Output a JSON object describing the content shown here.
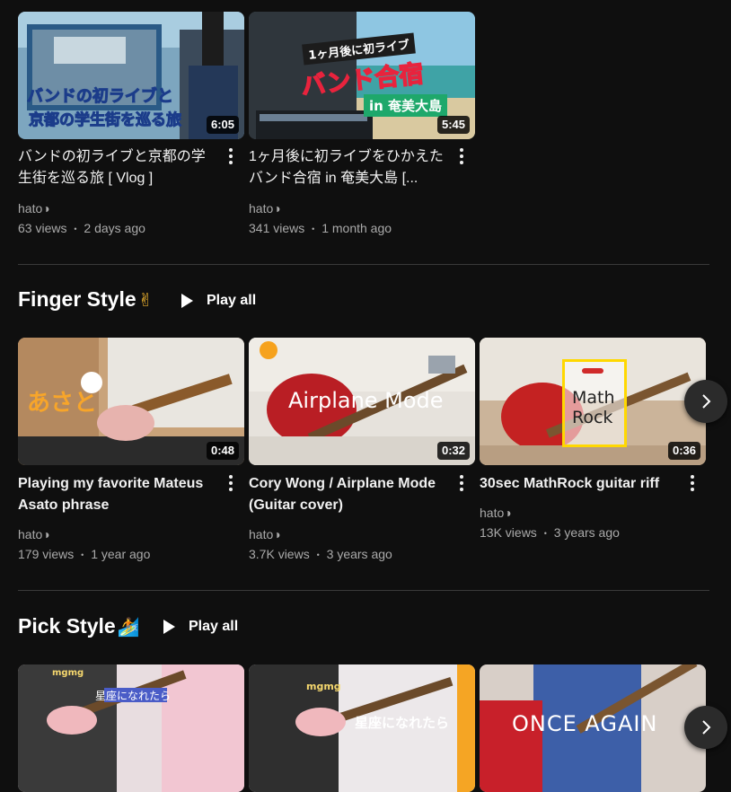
{
  "top_row": [
    {
      "title": "バンドの初ライブと京都の学生街を巡る旅 [ Vlog ]",
      "channel": "hato◑",
      "views": "63 views",
      "age": "2 days ago",
      "duration": "6:05",
      "overlay_line1": "バンドの初ライブと",
      "overlay_line2": "京都の学生街を巡る旅"
    },
    {
      "title": "1ヶ月後に初ライブをひかえたバンド合宿 in 奄美大島 [...",
      "channel": "hato◑",
      "views": "341 views",
      "age": "1 month ago",
      "duration": "5:45",
      "overlay_top": "1ヶ月後に初ライブ",
      "overlay_main": "バンド合宿",
      "overlay_badge": "in 奄美大島"
    }
  ],
  "shelves": [
    {
      "title": "Finger Style",
      "emoji": "✌",
      "play_all_label": "Play all",
      "videos": [
        {
          "title": "Playing my favorite Mateus Asato phrase",
          "channel": "hato◑",
          "views": "179 views",
          "age": "1 year ago",
          "duration": "0:48",
          "overlay": "あさと"
        },
        {
          "title": "Cory Wong / Airplane Mode (Guitar cover)",
          "channel": "hato◑",
          "views": "3.7K views",
          "age": "3 years ago",
          "duration": "0:32",
          "overlay": "Airplane Mode"
        },
        {
          "title": "30sec MathRock guitar riff",
          "channel": "hato◑",
          "views": "13K views",
          "age": "3 years ago",
          "duration": "0:36",
          "overlay_line1": "Math",
          "overlay_line2": "Rock"
        }
      ]
    },
    {
      "title": "Pick Style",
      "emoji": "🏄",
      "play_all_label": "Play all",
      "videos": [
        {
          "overlay": "星座になれたら",
          "overlay2": "mgmg"
        },
        {
          "overlay": "星座になれたら",
          "overlay2": "mgmg"
        },
        {
          "overlay": "ONCE AGAIN"
        }
      ]
    }
  ],
  "meta_separator": "•",
  "colors": {
    "background": "#0f0f0f",
    "text_primary": "#f1f1f1",
    "text_secondary": "#aaaaaa",
    "divider": "#3a3a3a"
  },
  "icons": {
    "more": "kebab-vertical-icon",
    "play": "play-triangle-icon",
    "next": "chevron-right-icon"
  }
}
